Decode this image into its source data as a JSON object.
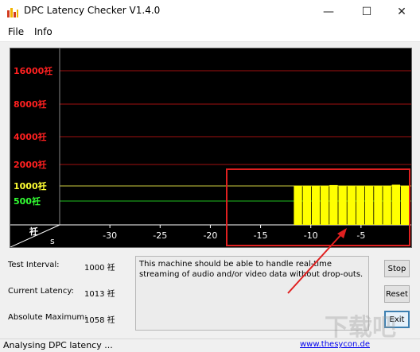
{
  "window": {
    "title": "DPC Latency Checker V1.4.0",
    "controls": [
      "minimize",
      "maximize",
      "close"
    ]
  },
  "menu": {
    "items": [
      "File",
      "Info"
    ]
  },
  "chart_data": {
    "type": "bar",
    "title": "",
    "xlabel": "s",
    "ylabel": "",
    "x_ticks": [
      -30,
      -25,
      -20,
      -15,
      -10,
      -5
    ],
    "xlim": [
      -35,
      0
    ],
    "y_scale": "categorical-log",
    "y_tick_labels": [
      "16000祍",
      "8000祍",
      "4000祍",
      "2000祍",
      "1000祍",
      "500祍"
    ],
    "y_tick_colors": [
      "#ff2020",
      "#ff2020",
      "#ff2020",
      "#ff2020",
      "#ffff33",
      "#33ff33"
    ],
    "gridline_colors": [
      "#a01010",
      "#a01010",
      "#a01010",
      "#a01010",
      "#d0d040",
      "#20c020"
    ],
    "y_unit_label": "祍",
    "series": [
      {
        "values": [
          1013,
          1013,
          1013,
          1013,
          1040,
          1013,
          1013,
          1013,
          1013,
          1013,
          1013,
          1058,
          1013
        ],
        "color": "#ffff00"
      }
    ],
    "highlight_box_color": "#e02020",
    "arrow_color": "#e02020"
  },
  "stats": {
    "test_interval_label": "Test Interval:",
    "test_interval_value": "1000 祍",
    "current_latency_label": "Current Latency:",
    "current_latency_value": "1013 祍",
    "absolute_maximum_label": "Absolute Maximum:",
    "absolute_maximum_value": "1058 祍"
  },
  "message": "This machine should be able to handle real-time streaming of audio and/or video data without drop-outs.",
  "buttons": {
    "stop": "Stop",
    "reset": "Reset",
    "exit": "Exit"
  },
  "status": {
    "text": "Analysing DPC latency ...",
    "link": "www.thesycon.de"
  },
  "watermark": {
    "text": "下载吧"
  }
}
